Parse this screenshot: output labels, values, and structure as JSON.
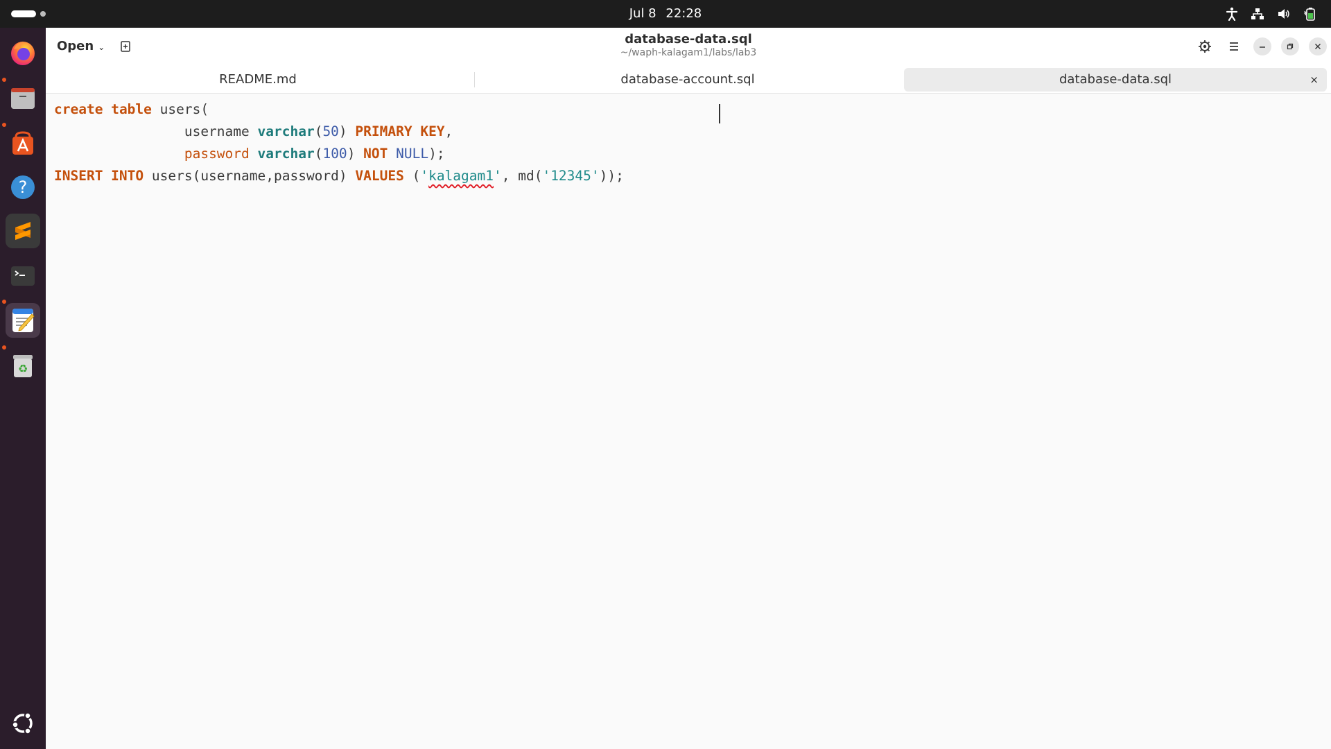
{
  "topbar": {
    "date": "Jul 8",
    "time": "22:28",
    "tray_icons": [
      "accessibility-icon",
      "network-icon",
      "volume-icon",
      "battery-icon"
    ]
  },
  "dock": {
    "items": [
      {
        "name": "firefox",
        "icon": "firefox-icon",
        "running": true
      },
      {
        "name": "files",
        "icon": "files-icon",
        "running": true
      },
      {
        "name": "app-center",
        "icon": "app-center-icon",
        "running": false
      },
      {
        "name": "help",
        "icon": "help-icon",
        "running": false
      },
      {
        "name": "sublime-text",
        "icon": "sublime-icon",
        "running": false
      },
      {
        "name": "terminal",
        "icon": "terminal-icon",
        "running": true
      },
      {
        "name": "text-editor",
        "icon": "text-editor-icon",
        "running": true,
        "active": true
      },
      {
        "name": "trash",
        "icon": "trash-icon",
        "running": false
      }
    ],
    "show_apps_icon": "ubuntu-logo-icon"
  },
  "window": {
    "open_label": "Open",
    "title": "database-data.sql",
    "subtitle": "~/waph-kalagam1/labs/lab3"
  },
  "tabs": [
    {
      "label": "README.md",
      "active": false
    },
    {
      "label": "database-account.sql",
      "active": false
    },
    {
      "label": "database-data.sql",
      "active": true
    }
  ],
  "tab_close_glyph": "×",
  "editor": {
    "line1": {
      "t1": "create",
      "t2": " ",
      "t3": "table",
      "t4": " users("
    },
    "line2": {
      "t1": "                username ",
      "t2": "varchar",
      "t3": "(",
      "t4": "50",
      "t5": ") ",
      "t6": "PRIMARY KEY",
      "t7": ","
    },
    "line3": {
      "t1": "                ",
      "t2": "password",
      "t3": " ",
      "t4": "varchar",
      "t5": "(",
      "t6": "100",
      "t7": ") ",
      "t8": "NOT",
      "t9": " ",
      "t10": "NULL",
      "t11": ");"
    },
    "line4": {
      "t1": "INSERT INTO",
      "t2": " users(username,password) ",
      "t3": "VALUES",
      "t4": " (",
      "t5": "'",
      "t6": "kalagam1",
      "t7": "'",
      "t8": ", md(",
      "t9": "'12345'",
      "t10": "));"
    }
  },
  "colors": {
    "keyword": "#c4500c",
    "type": "#1e7b7b",
    "number": "#3c5aa8",
    "string": "#1e8a8a",
    "dock_running_dot": "#e95420",
    "topbar_bg": "#1d1d1d",
    "dock_bg": "#2b1d2b"
  }
}
